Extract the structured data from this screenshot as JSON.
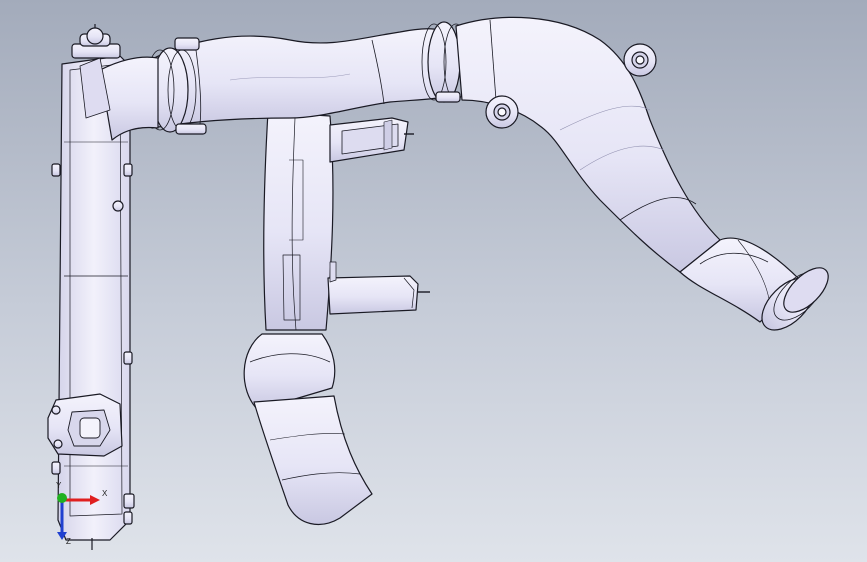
{
  "viewport": {
    "background_top": "#a3abbb",
    "background_bottom": "#dfe3ea"
  },
  "model": {
    "fill_color": "#ebeaf8",
    "shade_color": "#c4c3df",
    "edge_color": "#1a1a24"
  },
  "triad": {
    "x_label": "X",
    "y_label": "Y",
    "z_label": "Z",
    "x_color": "#e02020",
    "y_color": "#20b020",
    "z_color": "#2040d0"
  }
}
